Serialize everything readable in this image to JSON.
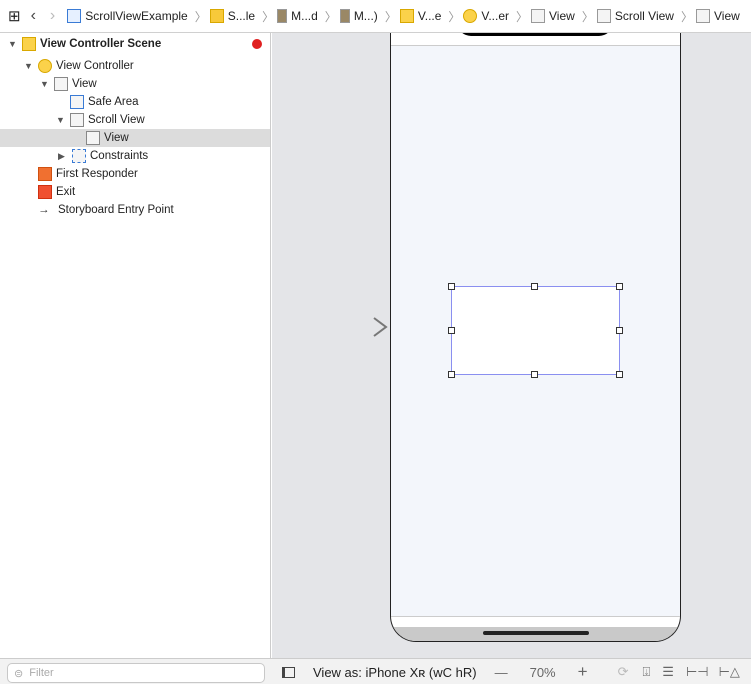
{
  "breadcrumb": {
    "items": [
      {
        "label": "ScrollViewExample",
        "icon": "project-file-icon"
      },
      {
        "label": "S...le",
        "icon": "folder-icon"
      },
      {
        "label": "M...d",
        "icon": "storyboard-file-icon"
      },
      {
        "label": "M...)",
        "icon": "storyboard-file-icon"
      },
      {
        "label": "V...e",
        "icon": "scene-icon"
      },
      {
        "label": "V...er",
        "icon": "view-controller-icon"
      },
      {
        "label": "View",
        "icon": "view-icon"
      },
      {
        "label": "Scroll View",
        "icon": "scroll-view-icon"
      },
      {
        "label": "View",
        "icon": "view-icon"
      }
    ]
  },
  "outline": {
    "items": [
      {
        "label": "View Controller Scene",
        "bold": true
      },
      {
        "label": "View Controller"
      },
      {
        "label": "View"
      },
      {
        "label": "Safe Area"
      },
      {
        "label": "Scroll View"
      },
      {
        "label": "View",
        "selected": true
      },
      {
        "label": "Constraints"
      },
      {
        "label": "First Responder"
      },
      {
        "label": "Exit"
      },
      {
        "label": "Storyboard Entry Point"
      }
    ]
  },
  "filter": {
    "placeholder": "Filter"
  },
  "bottom": {
    "view_as": "View as: iPhone Xʀ (wC hR)",
    "zoom": "70%",
    "minus": "—",
    "plus": "+"
  },
  "colors": {
    "selection": "#dcdcdc",
    "canvas": "#e4e5e8",
    "handle_border": "#8a8ff0",
    "warning": "#f5c400",
    "error": "#e02020"
  }
}
